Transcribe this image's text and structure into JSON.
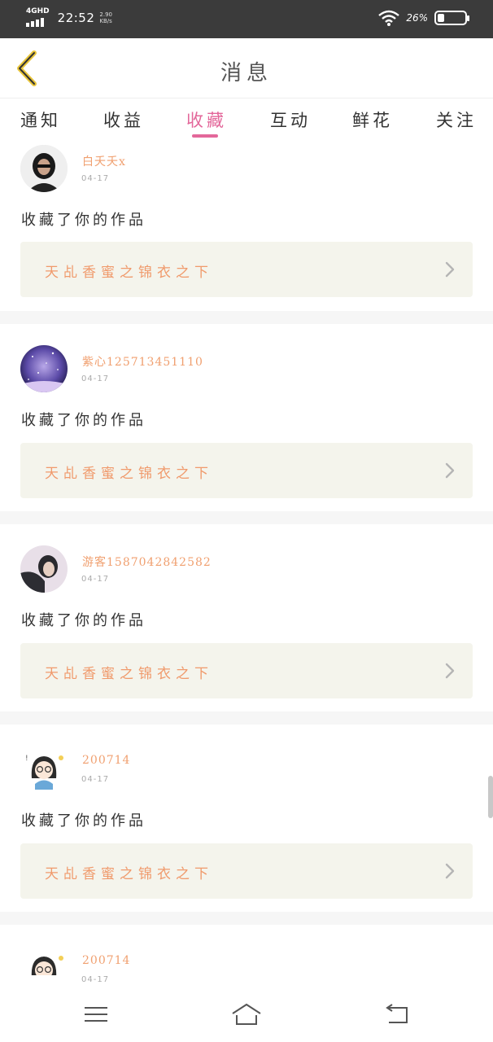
{
  "status_bar": {
    "network": "4GHD",
    "time": "22:52",
    "speed_value": "2.90",
    "speed_unit": "KB/s",
    "battery_percent": "26%",
    "battery_level": 0.26
  },
  "header": {
    "title": "消息"
  },
  "tabs": [
    {
      "label": "通知",
      "active": false
    },
    {
      "label": "收益",
      "active": false
    },
    {
      "label": "收藏",
      "active": true
    },
    {
      "label": "互动",
      "active": false
    },
    {
      "label": "鲜花",
      "active": false
    },
    {
      "label": "关注",
      "active": false
    }
  ],
  "messages": [
    {
      "username": "白夭夭x",
      "date": "04-17",
      "action": "收藏了你的作品",
      "work_title": "天乩香蜜之锦衣之下",
      "avatar": "dark-hair-avatar"
    },
    {
      "username": "紫心125713451110",
      "date": "04-17",
      "action": "收藏了你的作品",
      "work_title": "天乩香蜜之锦衣之下",
      "avatar": "starry-sky-avatar"
    },
    {
      "username": "游客1587042842582",
      "date": "04-17",
      "action": "收藏了你的作品",
      "work_title": "天乩香蜜之锦衣之下",
      "avatar": "person-avatar"
    },
    {
      "username": "200714",
      "date": "04-17",
      "action": "收藏了你的作品",
      "work_title": "天乩香蜜之锦衣之下",
      "avatar": "cartoon-girl-avatar"
    },
    {
      "username": "200714",
      "date": "04-17",
      "action": "",
      "work_title": "",
      "avatar": "cartoon-girl-avatar"
    }
  ],
  "colors": {
    "accent": "#e3679a",
    "username": "#f0a070",
    "work_title": "#f09a6c",
    "work_bg": "#f4f4ec",
    "status_bar": "#3b3b3b",
    "back_arrow": "#e8c53a"
  },
  "navbar": {
    "icons": [
      "menu-icon",
      "home-icon",
      "back-icon"
    ]
  }
}
